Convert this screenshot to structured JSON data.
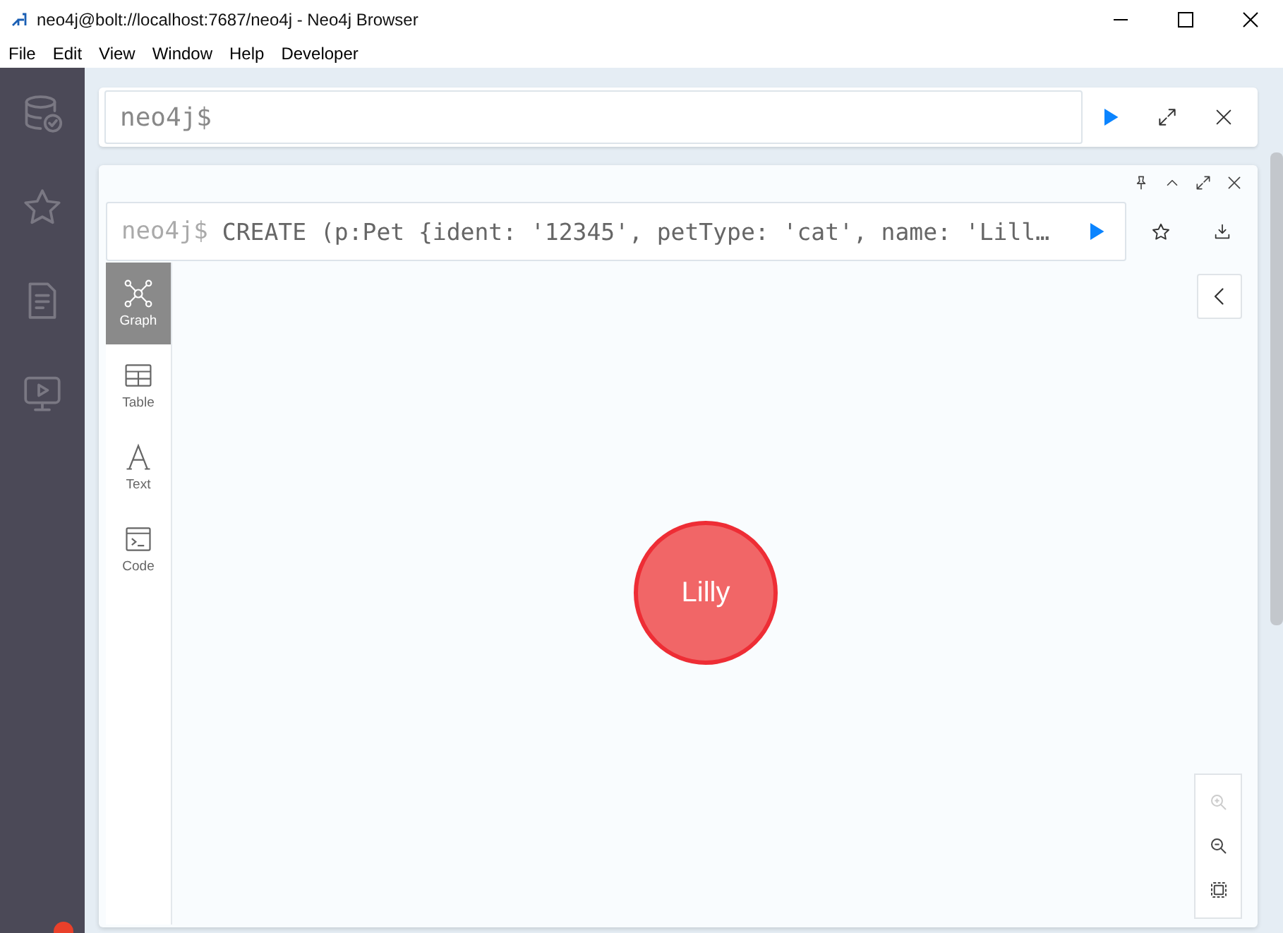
{
  "window": {
    "title": "neo4j@bolt://localhost:7687/neo4j - Neo4j Browser"
  },
  "menu": [
    "File",
    "Edit",
    "View",
    "Window",
    "Help",
    "Developer"
  ],
  "sidebar": {
    "items": [
      {
        "kind": "database"
      },
      {
        "kind": "favorites"
      },
      {
        "kind": "documents"
      },
      {
        "kind": "guides"
      }
    ],
    "notification": true
  },
  "editor": {
    "placeholder": "neo4j$"
  },
  "result": {
    "prompt": "neo4j$",
    "query": "CREATE (p:Pet {ident: '12345', petType: 'cat', name: 'Lill…",
    "views": [
      {
        "kind": "graph",
        "label": "Graph",
        "selected": true
      },
      {
        "kind": "table",
        "label": "Table",
        "selected": false
      },
      {
        "kind": "text",
        "label": "Text",
        "selected": false
      },
      {
        "kind": "code",
        "label": "Code",
        "selected": false
      }
    ],
    "nodes": [
      {
        "label": "Lilly",
        "color": "#f16667"
      }
    ],
    "zoom": [
      {
        "kind": "zoom-in",
        "disabled": true
      },
      {
        "kind": "zoom-out",
        "disabled": false
      },
      {
        "kind": "fit",
        "disabled": false
      }
    ]
  }
}
